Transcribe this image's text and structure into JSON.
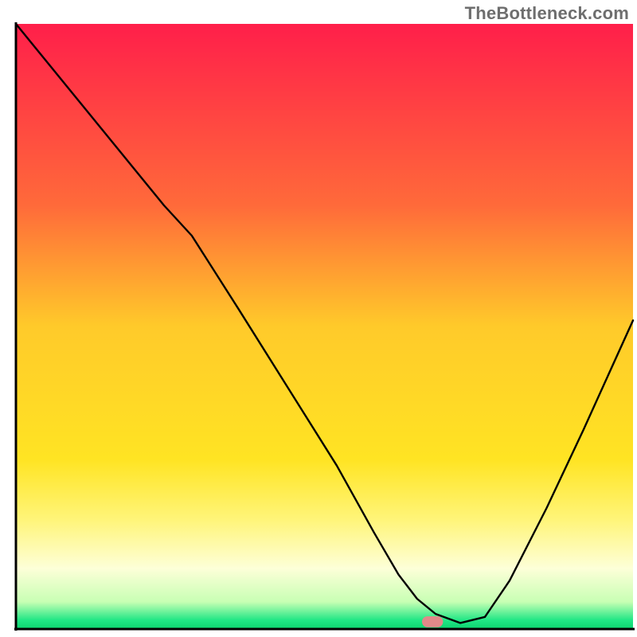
{
  "watermark": "TheBottleneck.com",
  "chart_data": {
    "type": "line",
    "title": "",
    "xlabel": "",
    "ylabel": "",
    "xlim": [
      0,
      100
    ],
    "ylim": [
      0,
      100
    ],
    "legend": false,
    "background_gradient": [
      {
        "pos": 0.0,
        "color": "#ff1f4a"
      },
      {
        "pos": 0.3,
        "color": "#ff6a3a"
      },
      {
        "pos": 0.5,
        "color": "#ffca2a"
      },
      {
        "pos": 0.72,
        "color": "#ffe423"
      },
      {
        "pos": 0.82,
        "color": "#fff57a"
      },
      {
        "pos": 0.9,
        "color": "#fdffd8"
      },
      {
        "pos": 0.955,
        "color": "#c8ffb4"
      },
      {
        "pos": 0.985,
        "color": "#22e786"
      },
      {
        "pos": 1.0,
        "color": "#0cd46e"
      }
    ],
    "series": [
      {
        "name": "bottleneck-curve",
        "color": "#000000",
        "x": [
          0,
          8,
          16,
          24,
          28.5,
          36,
          44,
          52,
          58,
          62,
          65,
          68,
          72,
          76,
          80,
          86,
          92,
          100
        ],
        "y": [
          100,
          90,
          80,
          70,
          65,
          53,
          40,
          27,
          16,
          9,
          5,
          2.5,
          1,
          2,
          8,
          20,
          33,
          51
        ]
      }
    ],
    "marker": {
      "name": "optimal-point",
      "x": 67.5,
      "y": 1.2,
      "color": "#e08989",
      "width": 3.4,
      "height": 1.8
    }
  }
}
